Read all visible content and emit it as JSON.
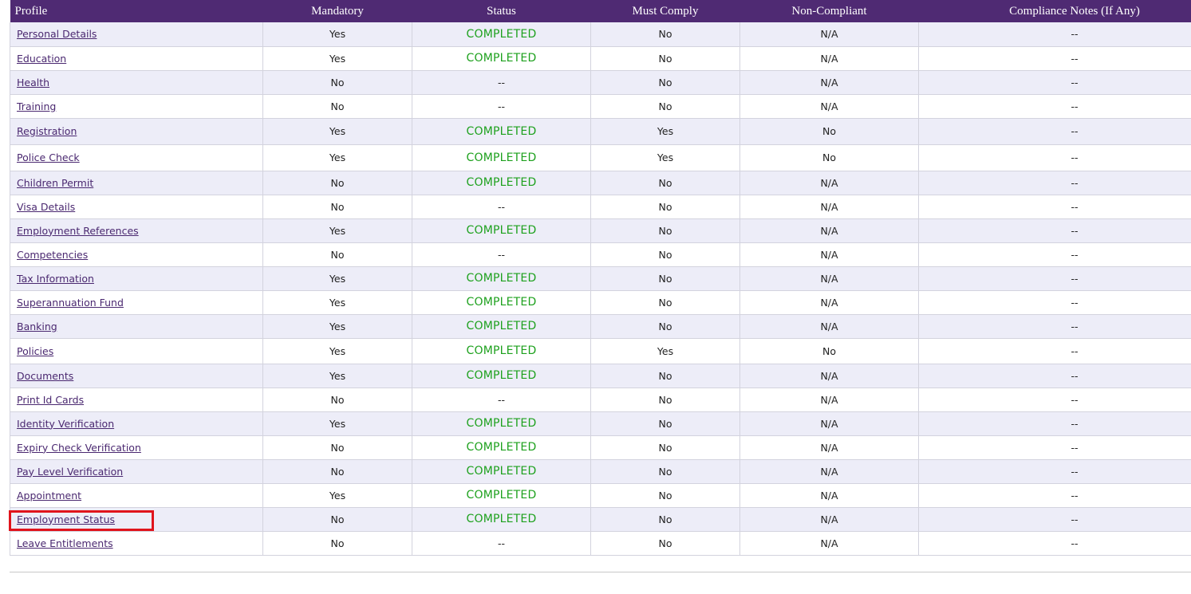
{
  "table": {
    "headers": {
      "profile": "Profile",
      "mandatory": "Mandatory",
      "status": "Status",
      "must_comply": "Must Comply",
      "non_compliant": "Non-Compliant",
      "notes": "Compliance Notes (If Any)"
    },
    "rows": [
      {
        "profile": "Personal Details",
        "mandatory": "Yes",
        "status": "COMPLETED",
        "must_comply": "No",
        "non_compliant": "N/A",
        "notes": "--"
      },
      {
        "profile": "Education",
        "mandatory": "Yes",
        "status": "COMPLETED",
        "must_comply": "No",
        "non_compliant": "N/A",
        "notes": "--"
      },
      {
        "profile": "Health",
        "mandatory": "No",
        "status": "--",
        "must_comply": "No",
        "non_compliant": "N/A",
        "notes": "--"
      },
      {
        "profile": "Training",
        "mandatory": "No",
        "status": "--",
        "must_comply": "No",
        "non_compliant": "N/A",
        "notes": "--"
      },
      {
        "profile": "Registration",
        "mandatory": "Yes",
        "status": "COMPLETED",
        "must_comply": "Yes",
        "non_compliant": "No",
        "notes": "--"
      },
      {
        "profile": "Police Check",
        "mandatory": "Yes",
        "status": "COMPLETED",
        "must_comply": "Yes",
        "non_compliant": "No",
        "notes": "--"
      },
      {
        "profile": "Children Permit",
        "mandatory": "No",
        "status": "COMPLETED",
        "must_comply": "No",
        "non_compliant": "N/A",
        "notes": "--"
      },
      {
        "profile": "Visa Details",
        "mandatory": "No",
        "status": "--",
        "must_comply": "No",
        "non_compliant": "N/A",
        "notes": "--"
      },
      {
        "profile": "Employment References",
        "mandatory": "Yes",
        "status": "COMPLETED",
        "must_comply": "No",
        "non_compliant": "N/A",
        "notes": "--"
      },
      {
        "profile": "Competencies",
        "mandatory": "No",
        "status": "--",
        "must_comply": "No",
        "non_compliant": "N/A",
        "notes": "--"
      },
      {
        "profile": "Tax Information",
        "mandatory": "Yes",
        "status": "COMPLETED",
        "must_comply": "No",
        "non_compliant": "N/A",
        "notes": "--"
      },
      {
        "profile": "Superannuation Fund",
        "mandatory": "Yes",
        "status": "COMPLETED",
        "must_comply": "No",
        "non_compliant": "N/A",
        "notes": "--"
      },
      {
        "profile": "Banking",
        "mandatory": "Yes",
        "status": "COMPLETED",
        "must_comply": "No",
        "non_compliant": "N/A",
        "notes": "--"
      },
      {
        "profile": "Policies",
        "mandatory": "Yes",
        "status": "COMPLETED",
        "must_comply": "Yes",
        "non_compliant": "No",
        "notes": "--"
      },
      {
        "profile": "Documents",
        "mandatory": "Yes",
        "status": "COMPLETED",
        "must_comply": "No",
        "non_compliant": "N/A",
        "notes": "--"
      },
      {
        "profile": "Print Id Cards",
        "mandatory": "No",
        "status": "--",
        "must_comply": "No",
        "non_compliant": "N/A",
        "notes": "--"
      },
      {
        "profile": "Identity Verification",
        "mandatory": "Yes",
        "status": "COMPLETED",
        "must_comply": "No",
        "non_compliant": "N/A",
        "notes": "--"
      },
      {
        "profile": "Expiry Check Verification",
        "mandatory": "No",
        "status": "COMPLETED",
        "must_comply": "No",
        "non_compliant": "N/A",
        "notes": "--"
      },
      {
        "profile": "Pay Level Verification",
        "mandatory": "No",
        "status": "COMPLETED",
        "must_comply": "No",
        "non_compliant": "N/A",
        "notes": "--"
      },
      {
        "profile": "Appointment",
        "mandatory": "Yes",
        "status": "COMPLETED",
        "must_comply": "No",
        "non_compliant": "N/A",
        "notes": "--"
      },
      {
        "profile": "Employment Status",
        "mandatory": "No",
        "status": "COMPLETED",
        "must_comply": "No",
        "non_compliant": "N/A",
        "notes": "--"
      },
      {
        "profile": "Leave Entitlements",
        "mandatory": "No",
        "status": "--",
        "must_comply": "No",
        "non_compliant": "N/A",
        "notes": "--"
      }
    ]
  },
  "colors": {
    "header_bg": "#4f2a73",
    "completed": "#1ea11e",
    "link": "#4a2870",
    "row_alt": "#ededf8",
    "highlight": "#e0141c"
  }
}
